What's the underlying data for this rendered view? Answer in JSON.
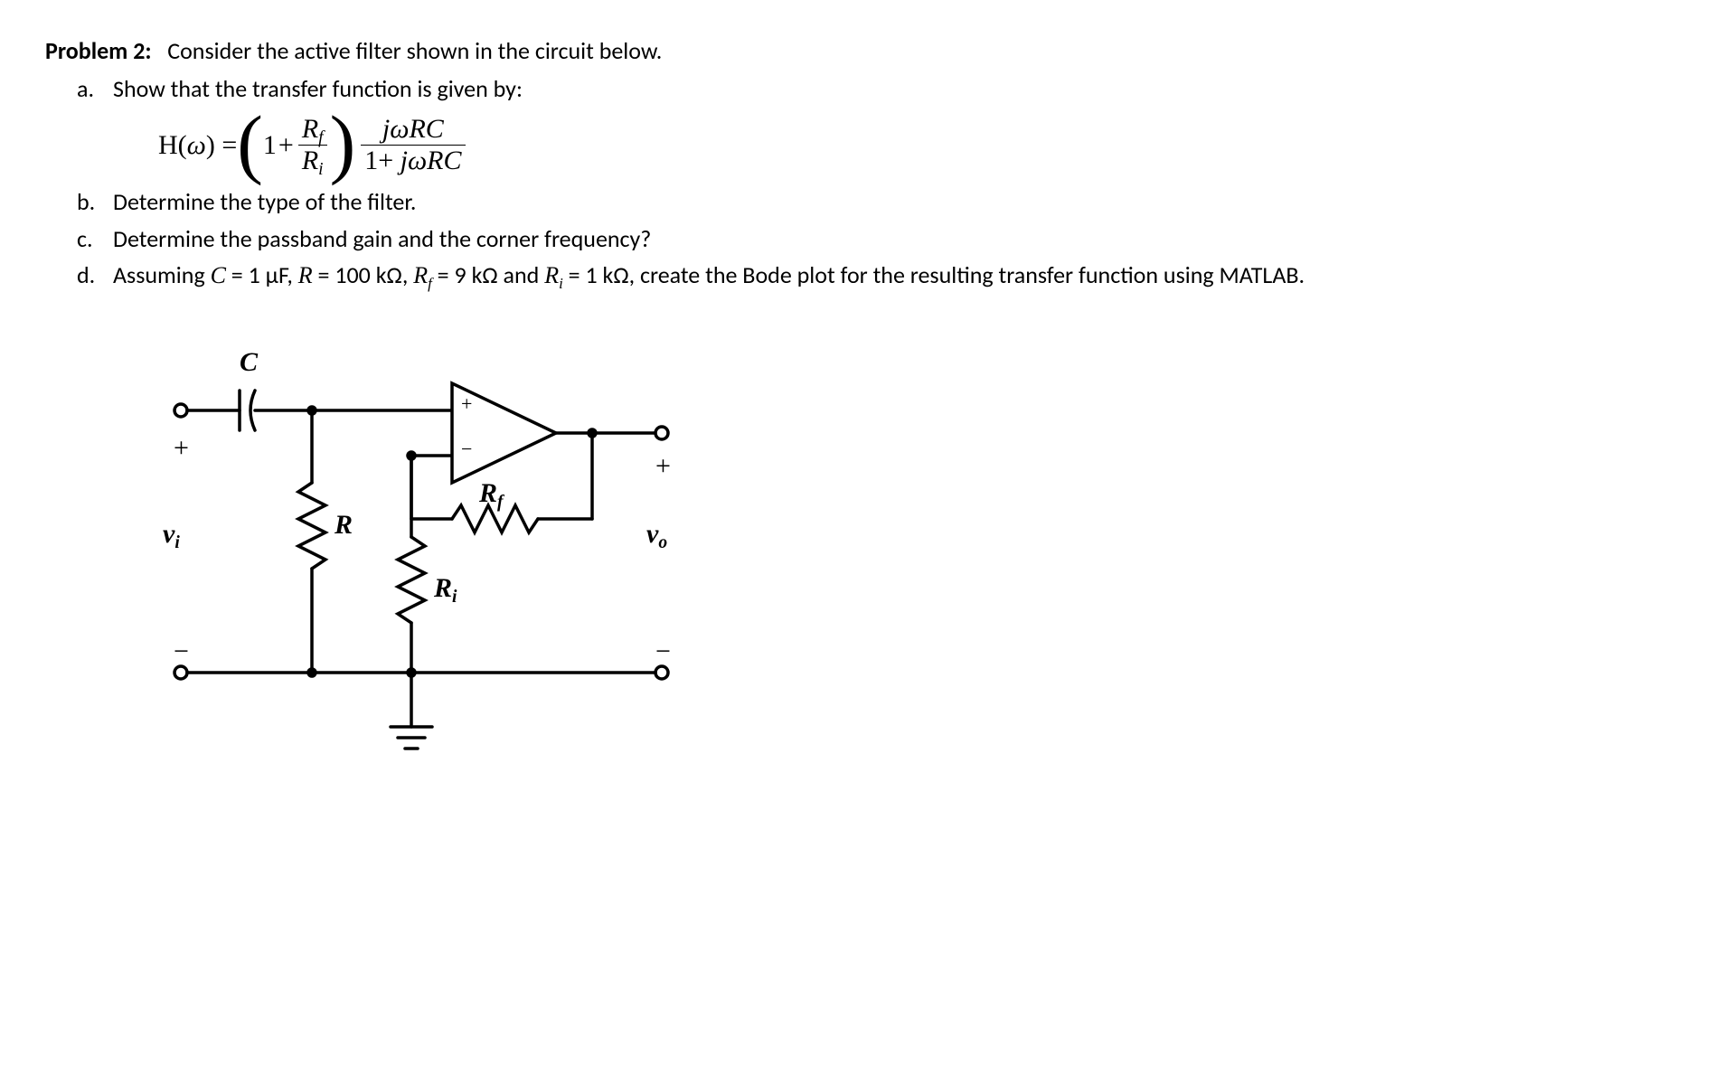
{
  "problem": {
    "label": "Problem 2:",
    "intro": "Consider the active filter shown in the circuit below.",
    "items": {
      "a": {
        "marker": "a.",
        "text": "Show that the transfer function is given by:"
      },
      "b": {
        "marker": "b.",
        "text": "Determine the type of the filter."
      },
      "c": {
        "marker": "c.",
        "text": "Determine the passband gain and the corner frequency?"
      },
      "d": {
        "marker": "d.",
        "text_pre": "Assuming ",
        "text_post": ", create the Bode plot for the resulting transfer function using MATLAB."
      }
    },
    "params": {
      "C": "1 µF",
      "R": "100 kΩ",
      "Rf": "9 kΩ",
      "Ri": "1 kΩ"
    }
  },
  "equation": {
    "lhs": "H(ω) =",
    "one": "1",
    "plus1": "+",
    "Rf": "R",
    "Rf_sub": "f",
    "Ri": "R",
    "Ri_sub": "i",
    "num2": "jωRC",
    "den2_pre": "1+ ",
    "den2": "jωRC"
  },
  "circuit": {
    "C": "C",
    "R": "R",
    "Rf": "R",
    "Rf_sub": "f",
    "Ri": "R",
    "Ri_sub": "i",
    "vi": "v",
    "vi_sub": "i",
    "vo": "v",
    "vo_sub": "o",
    "plus": "+",
    "minus": "−",
    "amp_plus": "+",
    "amp_minus": "−"
  }
}
